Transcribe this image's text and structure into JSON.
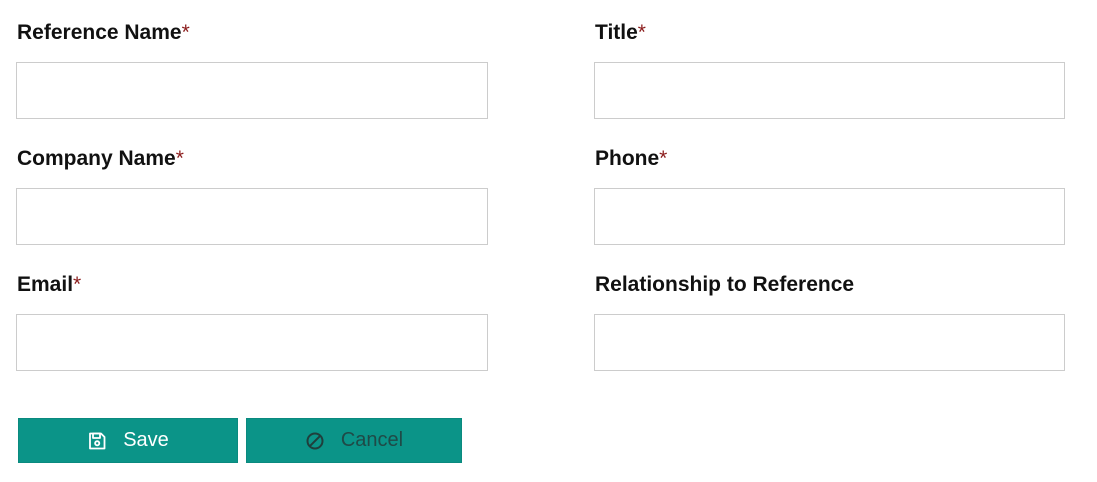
{
  "form": {
    "fields": [
      {
        "label": "Reference Name",
        "required_mark": "*",
        "value": ""
      },
      {
        "label": "Title",
        "required_mark": "*",
        "value": ""
      },
      {
        "label": "Company Name",
        "required_mark": "*",
        "value": ""
      },
      {
        "label": "Phone",
        "required_mark": "*",
        "value": ""
      },
      {
        "label": "Email",
        "required_mark": "*",
        "value": ""
      },
      {
        "label": "Relationship to Reference",
        "required_mark": "",
        "value": ""
      }
    ],
    "buttons": {
      "save_label": "Save",
      "save_icon": "save-icon",
      "cancel_label": "Cancel",
      "cancel_icon": "ban-icon"
    }
  },
  "colors": {
    "button_bg": "#0b9488",
    "required_mark": "#8b1c1c",
    "input_border": "#cccccc"
  }
}
